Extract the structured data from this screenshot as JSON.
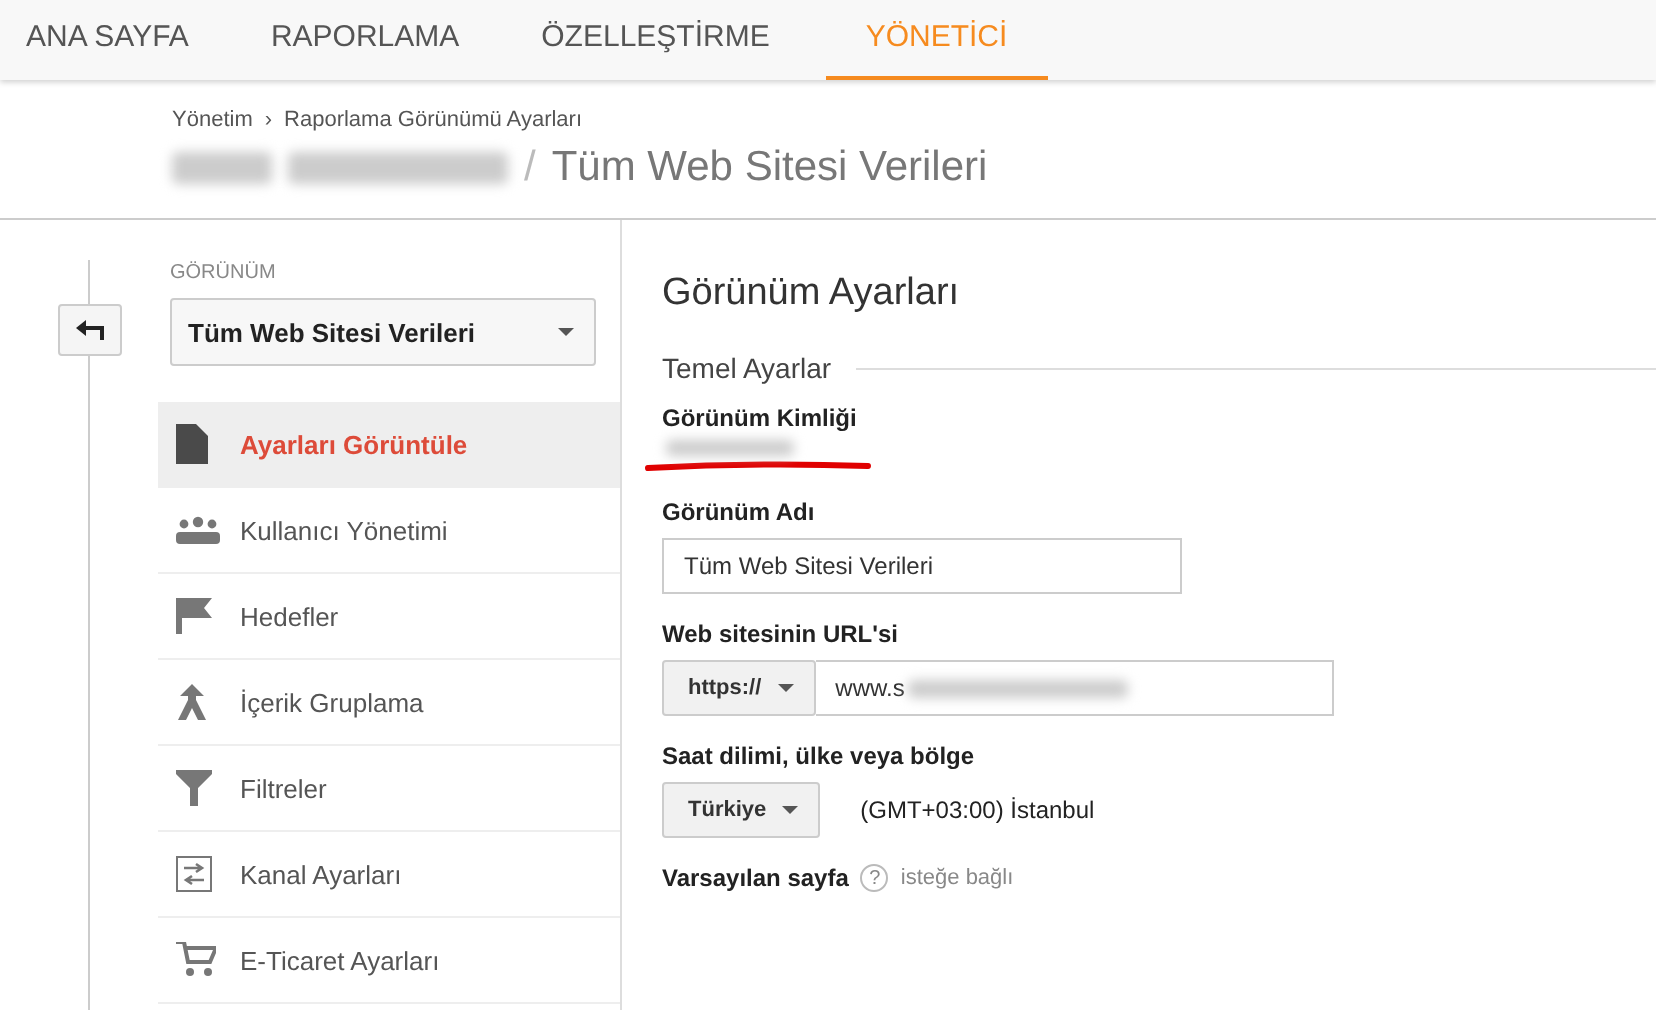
{
  "nav": {
    "tabs": [
      {
        "label": "ANA SAYFA",
        "selected": false
      },
      {
        "label": "RAPORLAMA",
        "selected": false
      },
      {
        "label": "ÖZELLEŞTİRME",
        "selected": false
      },
      {
        "label": "YÖNETİCİ",
        "selected": true
      }
    ]
  },
  "header": {
    "breadcrumb": [
      "Yönetim",
      "Raporlama Görünümü Ayarları"
    ],
    "breadcrumb_separator": "›",
    "title_separator": "/",
    "title": "Tüm Web Sitesi Verileri"
  },
  "sidebar": {
    "view_label": "GÖRÜNÜM",
    "view_select": "Tüm Web Sitesi Verileri",
    "items": [
      {
        "label": "Ayarları Görüntüle",
        "kind": "document",
        "selected": true
      },
      {
        "label": "Kullanıcı Yönetimi",
        "kind": "people",
        "selected": false
      },
      {
        "label": "Hedefler",
        "kind": "flag",
        "selected": false
      },
      {
        "label": "İçerik Gruplama",
        "kind": "merge",
        "selected": false
      },
      {
        "label": "Filtreler",
        "kind": "filter",
        "selected": false
      },
      {
        "label": "Kanal Ayarları",
        "kind": "channel",
        "selected": false
      },
      {
        "label": "E-Ticaret Ayarları",
        "kind": "cart",
        "selected": false
      }
    ]
  },
  "main": {
    "title": "Görünüm Ayarları",
    "section": "Temel Ayarlar",
    "fields": [
      {
        "kind": "readonly",
        "label": "Görünüm Kimliği",
        "underlined": true
      },
      {
        "kind": "text",
        "label": "Görünüm Adı",
        "value": "Tüm Web Sitesi Verileri"
      },
      {
        "kind": "url",
        "label": "Web sitesinin URL'si",
        "protocol": "https://",
        "value": "www.s"
      },
      {
        "kind": "timezone",
        "label": "Saat dilimi, ülke veya bölge",
        "country": "Türkiye",
        "timezone": "(GMT+03:00) İstanbul"
      },
      {
        "kind": "optional",
        "label": "Varsayılan sayfa",
        "help": "?",
        "note": "isteğe bağlı"
      }
    ]
  }
}
